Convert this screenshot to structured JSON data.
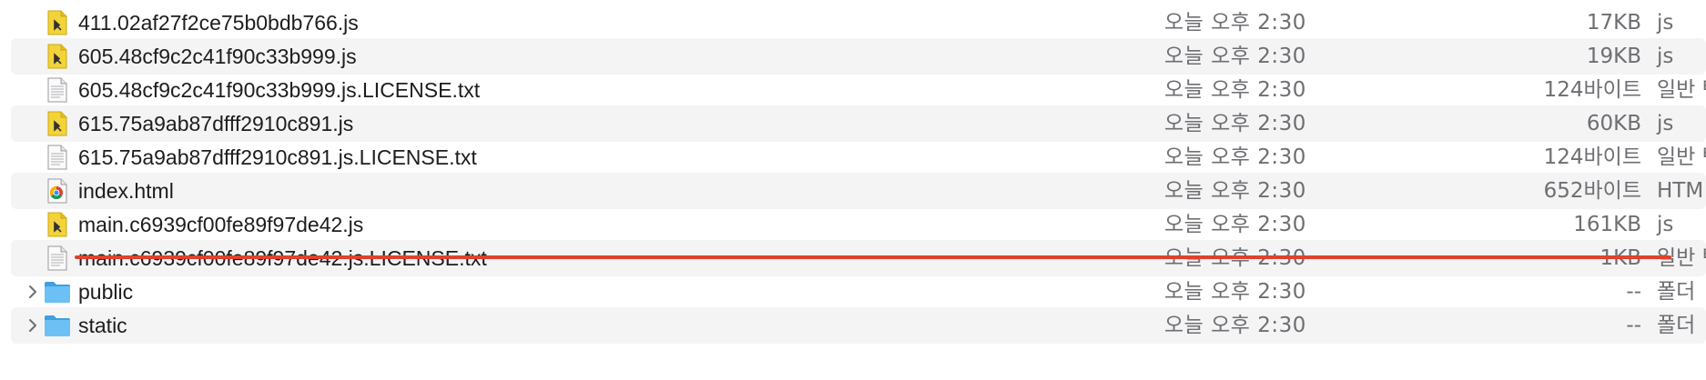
{
  "files": [
    {
      "name": "411.02af27f2ce75b0bdb766.js",
      "date": "오늘 오후 2:30",
      "size": "17KB",
      "kind": "js",
      "icon": "js-file-icon"
    },
    {
      "name": "605.48cf9c2c41f90c33b999.js",
      "date": "오늘 오후 2:30",
      "size": "19KB",
      "kind": "js",
      "icon": "js-file-icon"
    },
    {
      "name": "605.48cf9c2c41f90c33b999.js.LICENSE.txt",
      "date": "오늘 오후 2:30",
      "size": "124바이트",
      "kind": "일반 텍",
      "icon": "text-file-icon"
    },
    {
      "name": "615.75a9ab87dfff2910c891.js",
      "date": "오늘 오후 2:30",
      "size": "60KB",
      "kind": "js",
      "icon": "js-file-icon"
    },
    {
      "name": "615.75a9ab87dfff2910c891.js.LICENSE.txt",
      "date": "오늘 오후 2:30",
      "size": "124바이트",
      "kind": "일반 텍",
      "icon": "text-file-icon"
    },
    {
      "name": "index.html",
      "date": "오늘 오후 2:30",
      "size": "652바이트",
      "kind": "HTM",
      "icon": "chrome-html-icon"
    },
    {
      "name": "main.c6939cf00fe89f97de42.js",
      "date": "오늘 오후 2:30",
      "size": "161KB",
      "kind": "js",
      "icon": "js-file-icon"
    },
    {
      "name": "main.c6939cf00fe89f97de42.js.LICENSE.txt",
      "date": "오늘 오후 2:30",
      "size": "1KB",
      "kind": "일반 텍",
      "icon": "text-file-icon"
    },
    {
      "name": "public",
      "date": "오늘 오후 2:30",
      "size": "--",
      "kind": "폴더",
      "icon": "folder-icon"
    },
    {
      "name": "static",
      "date": "오늘 오후 2:30",
      "size": "--",
      "kind": "폴더",
      "icon": "folder-icon"
    }
  ],
  "colors": {
    "stripe": "#f4f4f5",
    "text": "#1d1d1f",
    "secondary_text": "#6e6e73",
    "js_icon": "#f3d23a",
    "folder": "#5fb6f0",
    "highlight_underline": "#e0412c"
  }
}
